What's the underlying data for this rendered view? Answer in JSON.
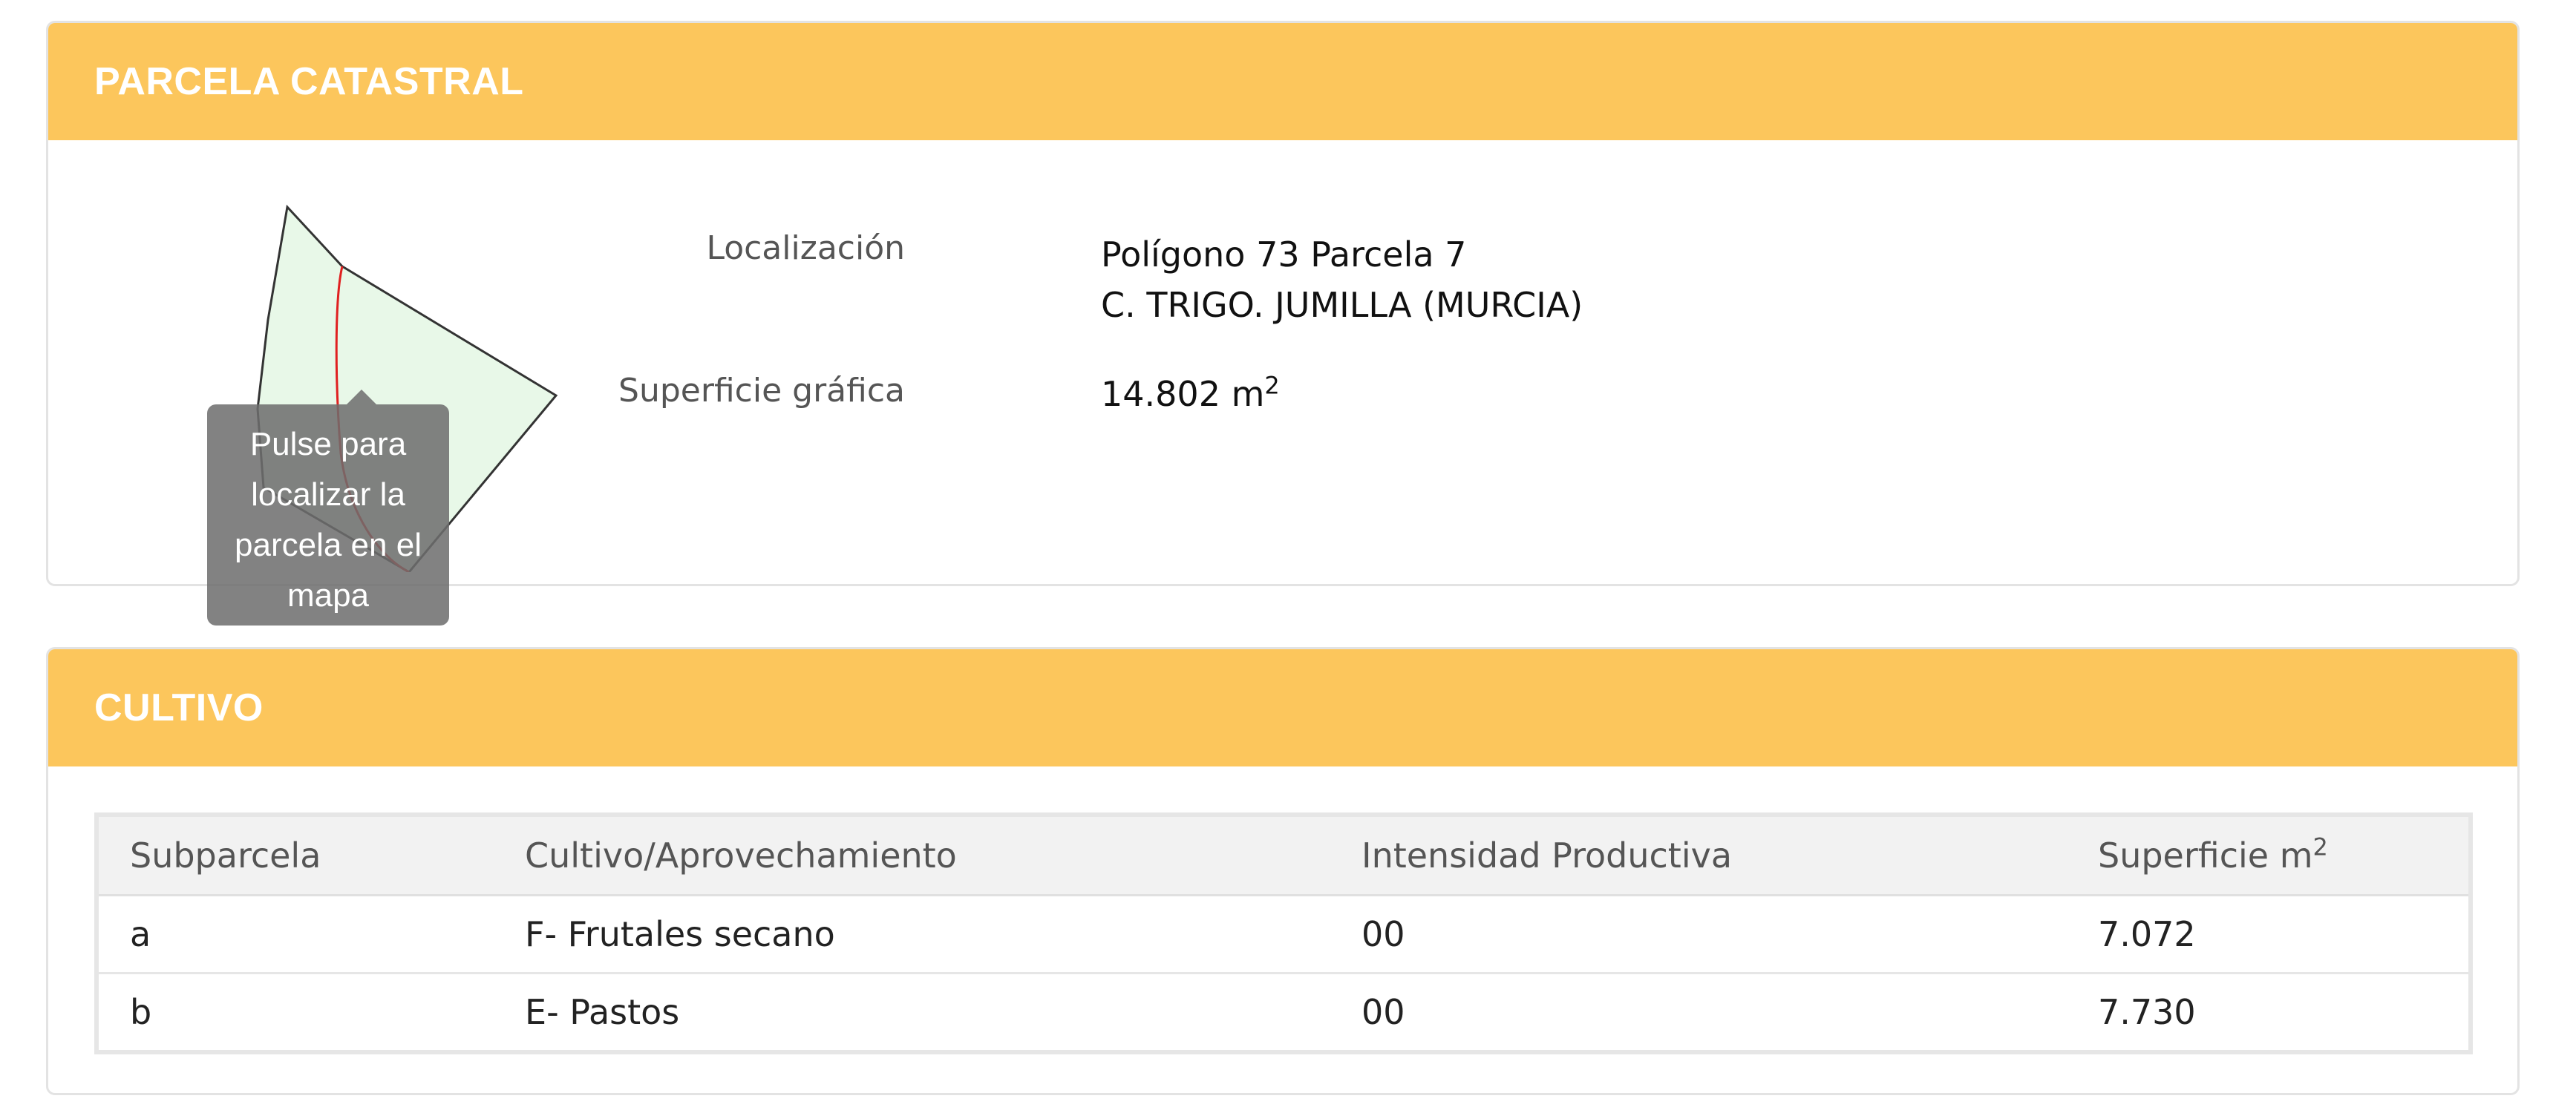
{
  "parcela": {
    "title": "PARCELA CATASTRAL",
    "tooltip": "Pulse para localizar la parcela en el mapa",
    "localizacion_label": "Localización",
    "localizacion_line1": "Polígono 73 Parcela 7",
    "localizacion_line2": "C. TRIGO. JUMILLA (MURCIA)",
    "superficie_label": "Superficie gráfica",
    "superficie_value": "14.802 m",
    "superficie_exp": "2"
  },
  "cultivo": {
    "title": "CULTIVO",
    "columns": [
      "Subparcela",
      "Cultivo/Aprovechamiento",
      "Intensidad Productiva",
      "Superficie m"
    ],
    "superficie_exp": "2",
    "rows": [
      {
        "subparcela": "a",
        "cultivo": "F- Frutales secano",
        "intensidad": "00",
        "superficie": "7.072"
      },
      {
        "subparcela": "b",
        "cultivo": "E- Pastos",
        "intensidad": "00",
        "superficie": "7.730"
      }
    ]
  },
  "colors": {
    "header_bg": "#fcc65c",
    "parcel_fill": "#e8f8e8",
    "parcel_outline": "#333333",
    "subparcel_line": "#e02020"
  }
}
